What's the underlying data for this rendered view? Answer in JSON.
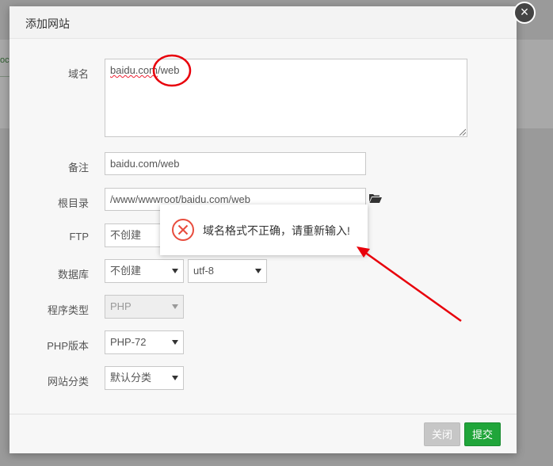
{
  "background": {
    "fragment": "oc"
  },
  "dialog": {
    "title": "添加网站",
    "close_label": "×",
    "fields": {
      "domain": {
        "label": "域名",
        "value_underlined": "baidu.com",
        "value_rest": "/web"
      },
      "remark": {
        "label": "备注",
        "value": "baidu.com/web"
      },
      "root_dir": {
        "label": "根目录",
        "value": "/www/wwwroot/baidu.com/web"
      },
      "ftp": {
        "label": "FTP",
        "value": "不创建"
      },
      "database": {
        "label": "数据库",
        "value": "不创建",
        "charset": "utf-8"
      },
      "program_type": {
        "label": "程序类型",
        "value": "PHP"
      },
      "php_version": {
        "label": "PHP版本",
        "value": "PHP-72"
      },
      "category": {
        "label": "网站分类",
        "value": "默认分类"
      }
    },
    "buttons": {
      "close": "关闭",
      "submit": "提交"
    }
  },
  "toast": {
    "message": "域名格式不正确，请重新输入!"
  },
  "colors": {
    "accent": "#20a53a",
    "error": "#e84c3d",
    "annotation": "#e8000b"
  },
  "icons": [
    "close-icon",
    "folder-open-icon",
    "error-circle-icon",
    "chevron-down-icon"
  ]
}
